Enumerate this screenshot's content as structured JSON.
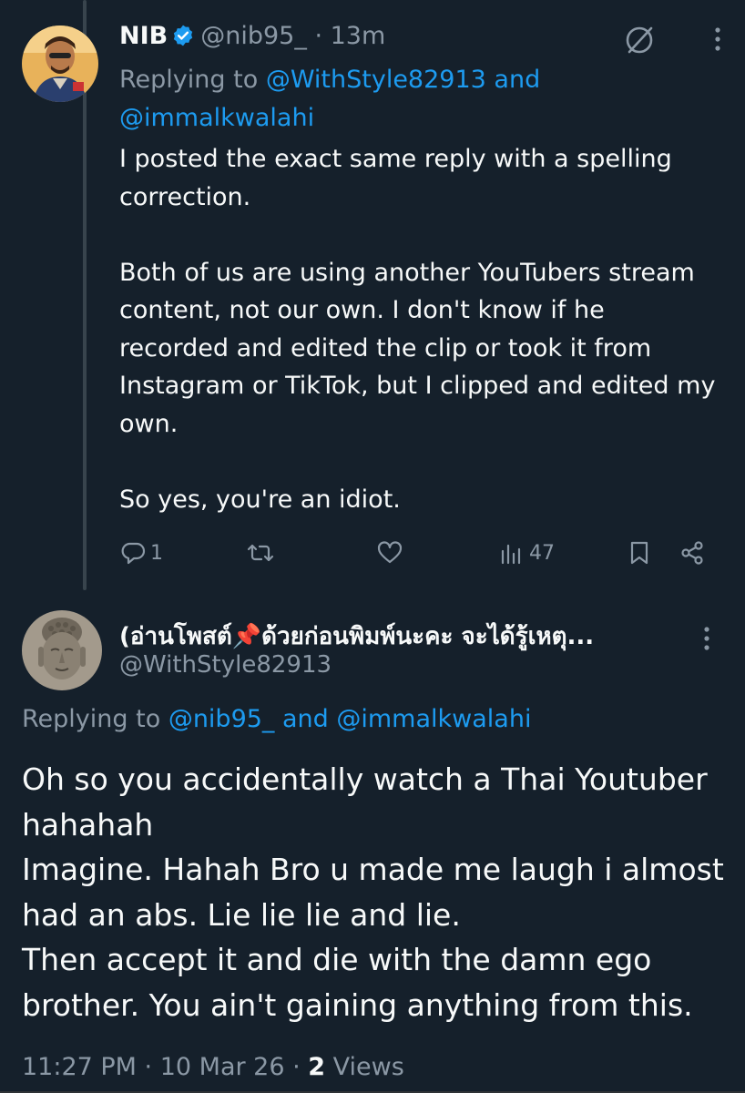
{
  "colors": {
    "background": "#15202b",
    "text": "#f7f9f9",
    "muted": "#8b98a5",
    "link": "#1d9bf0",
    "thread_line": "#38444d"
  },
  "tweet1": {
    "name": "NIB",
    "verified_icon": "verified-badge-icon",
    "handle": "@nib95_",
    "time": "· 13m",
    "replying_prefix": "Replying to",
    "replying_user1": "@WithStyle82913",
    "replying_and": "and",
    "replying_user2": "@immalkwalahi",
    "paragraphs": [
      "I posted the exact same reply with a spelling correction.",
      "Both of us are using another YouTubers stream content, not our own. I don't know if he recorded and edited the clip or took it from Instagram or TikTok, but I clipped and edited my own.",
      "So yes, you're an idiot."
    ],
    "actions": {
      "replies": "1",
      "retweets": "",
      "likes": "",
      "views": "47"
    }
  },
  "tweet2": {
    "name": "(อ่านโพสต์📌ด้วยก่อนพิมพ์นะคะ จะได้รู้เหตุ...",
    "handle": "@WithStyle82913",
    "replying_prefix": "Replying to",
    "replying_users": "@nib95_ and @immalkwalahi",
    "body": "Oh so you accidentally watch a Thai Youtuber hahahah\nImagine. Hahah Bro u made me laugh i almost had an abs. Lie lie lie and lie.\nThen accept it and die with the damn ego brother. You ain't gaining anything from this.",
    "meta_time": "11:27 PM · 10 Mar 26 · ",
    "meta_views_count": "2",
    "meta_views_label": " Views"
  }
}
